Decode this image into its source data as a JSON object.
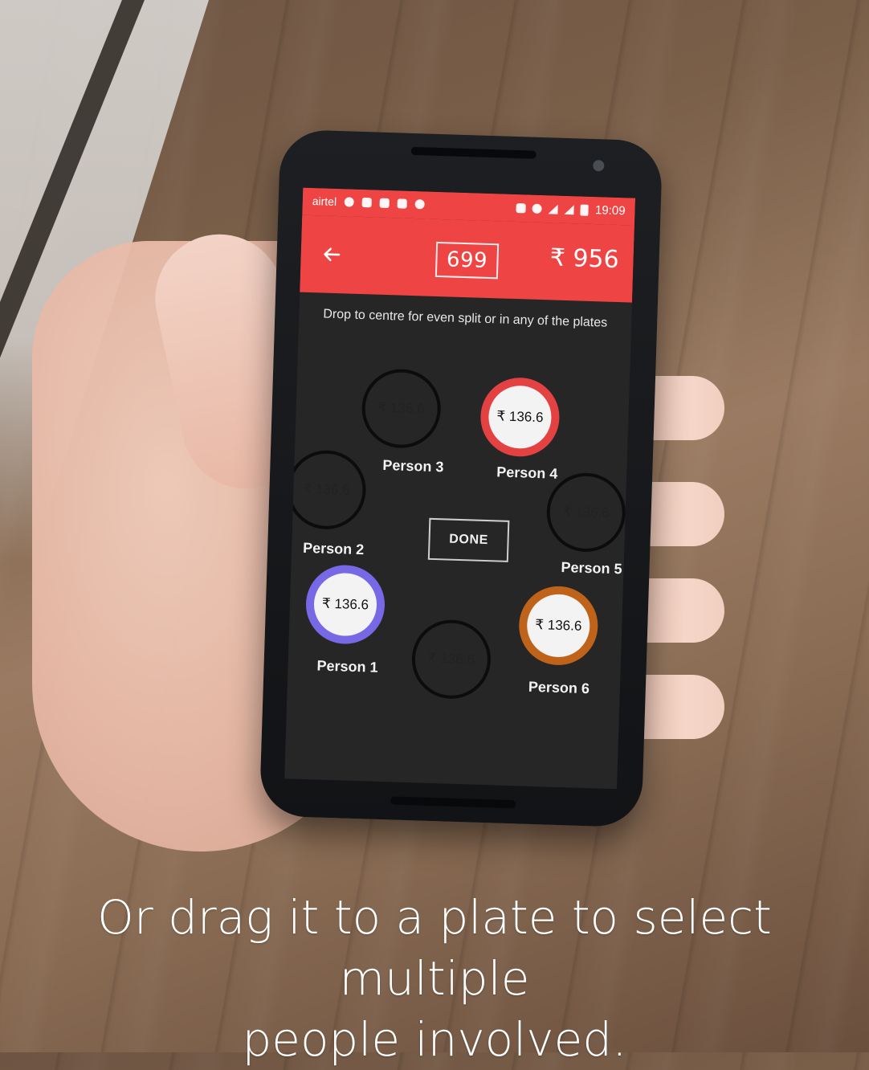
{
  "status_bar": {
    "carrier": "airtel",
    "time": "19:09",
    "icons_left": [
      "f-icon",
      "image-icon",
      "usb-icon",
      "warning-icon",
      "debug-icon"
    ],
    "icons_right": [
      "vibrate-icon",
      "alarm-icon",
      "wifi-icon",
      "signal-icon",
      "battery-icon"
    ]
  },
  "app_bar": {
    "back_icon": "arrow-left-icon",
    "center_value": "699",
    "total_value": "₹ 956"
  },
  "instruction": "Drop to centre for even split or in any of the plates",
  "done_label": "DONE",
  "plates": [
    {
      "amount": "₹ 136.6",
      "label": "Person 3",
      "active": false
    },
    {
      "amount": "₹ 136.6",
      "label": "Person 4",
      "active": true,
      "accent": "#ef4444"
    },
    {
      "amount": "₹ 136.6",
      "label": "Person 2",
      "active": false
    },
    {
      "amount": "₹ 136.6",
      "label": "Person 5",
      "active": false
    },
    {
      "amount": "₹ 136.6",
      "label": "Person 1",
      "active": true,
      "accent": "#7c6cf0"
    },
    {
      "amount": "₹ 136.6",
      "label": "Person 6",
      "active": true,
      "accent": "#c8671b"
    },
    {
      "amount": "₹ 136.6",
      "label": "",
      "active": false
    }
  ],
  "caption": {
    "line1": "Or drag it to a plate to select multiple",
    "line2": "people involved."
  },
  "colors": {
    "accent_red": "#ef4444",
    "accent_purple": "#7c6cf0",
    "accent_orange": "#c8671b",
    "screen_bg": "#262626"
  }
}
